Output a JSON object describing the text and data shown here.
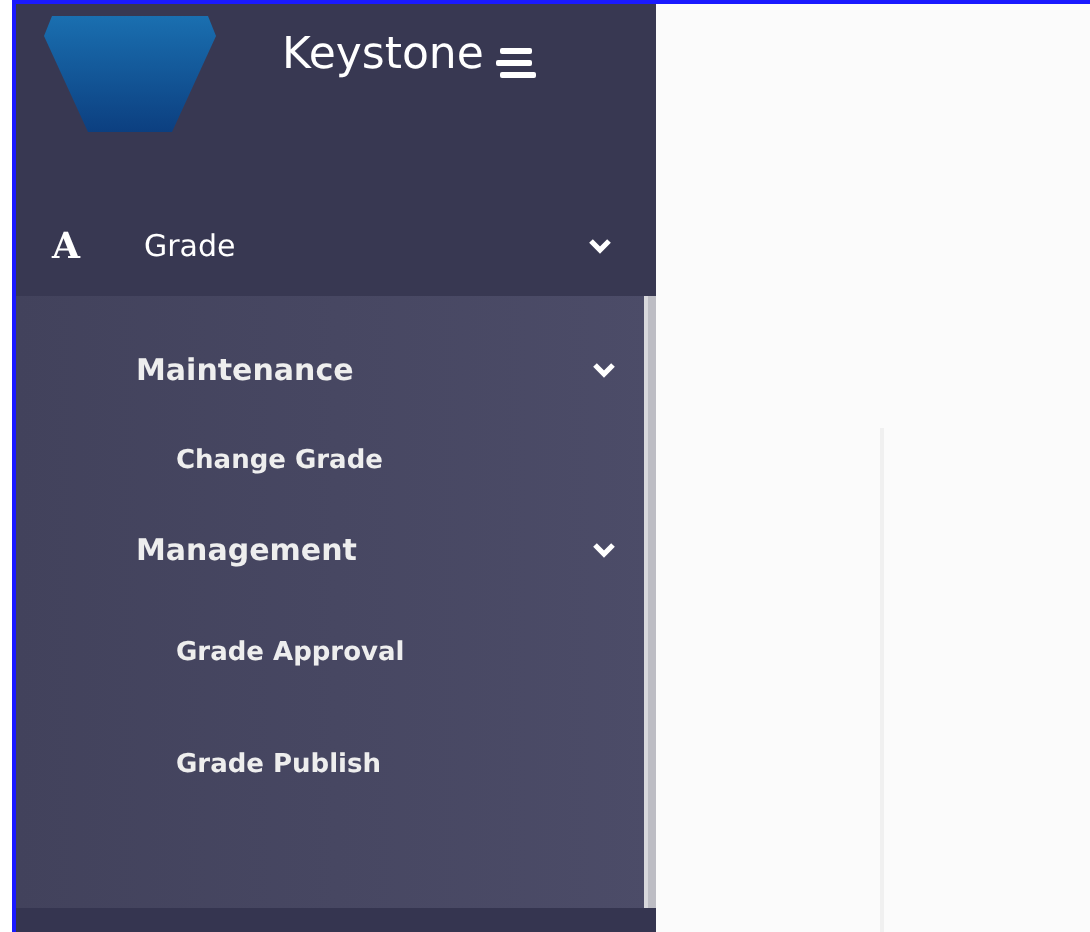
{
  "sidebar": {
    "brand": "Keystone",
    "menu": [
      {
        "icon": "A",
        "label": "Grade",
        "expanded": true,
        "children": [
          {
            "label": "Maintenance",
            "expanded": true,
            "children": [
              {
                "label": "Change Grade"
              }
            ]
          },
          {
            "label": "Management",
            "expanded": true,
            "children": [
              {
                "label": "Grade Approval"
              },
              {
                "label": "Grade Publish"
              }
            ]
          }
        ]
      }
    ]
  }
}
